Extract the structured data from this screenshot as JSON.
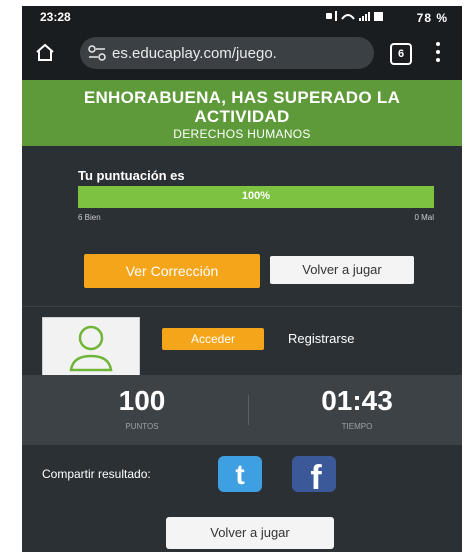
{
  "status_bar": {
    "time": "23:28",
    "icons": "• ♪ ▲ ▮ 78 %"
  },
  "browser": {
    "url": "es.educaplay.com/juego.",
    "tab_count": "6"
  },
  "banner": {
    "line1": "ENHORABUENA, HAS SUPERADO LA",
    "line2": "ACTIVIDAD",
    "line3": "DERECHOS HUMANOS",
    "color": "#5e9a39"
  },
  "score": {
    "label": "Tu puntuación es",
    "percent_text": "100%",
    "percent": 100,
    "correct": "6 Bien",
    "wrong": "0 Mal"
  },
  "buttons": {
    "correction": "Ver Corrección",
    "replay_top": "Volver a jugar",
    "replay_bottom": "Volver a jugar",
    "access": "Acceder",
    "register": "Registrarse"
  },
  "stats": {
    "points": "100",
    "points_label": "PUNTOS",
    "time": "01:43",
    "time_label": "TIEMPO"
  },
  "share": {
    "label": "Compartir resultado:",
    "twitter": "t",
    "facebook": "f"
  },
  "colors": {
    "accent": "#f5a51a",
    "bar": "#7ec242",
    "background": "#2b3034"
  }
}
